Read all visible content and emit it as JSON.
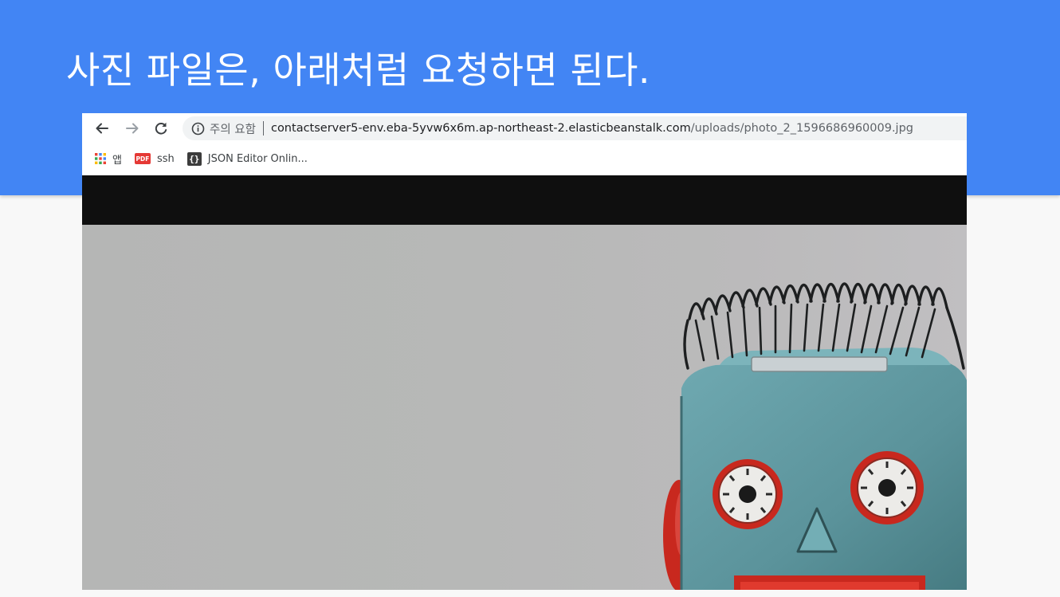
{
  "slide": {
    "title": "사진 파일은, 아래처럼 요청하면 된다."
  },
  "browser": {
    "nav": {
      "back_icon": "arrow-left-icon",
      "forward_icon": "arrow-right-icon",
      "reload_icon": "reload-icon"
    },
    "omnibox": {
      "security_icon": "info-icon",
      "security_label": "주의 요함",
      "url_host": "contactserver5-env.eba-5yvw6x6m.ap-northeast-2.elasticbeanstalk.com",
      "url_path": "/uploads/photo_2_1596686960009.jpg"
    },
    "bookmarks": [
      {
        "label": "앱",
        "icon": "apps-grid-icon"
      },
      {
        "label": "ssh",
        "icon": "pdf-icon",
        "badge": "PDF"
      },
      {
        "label": "JSON Editor Onlin...",
        "icon": "json-editor-icon",
        "badge": "{}"
      }
    ]
  },
  "content": {
    "image_subject": "tin toy robot head with coiled spring hair"
  },
  "colors": {
    "header": "#4285f4",
    "slide_bg": "#f8f8f8",
    "viewer_bg": "#0f0f0f",
    "photo_bg": "#b7b8b7",
    "robot_teal": "#5f9aa2",
    "robot_red": "#c8281e"
  }
}
